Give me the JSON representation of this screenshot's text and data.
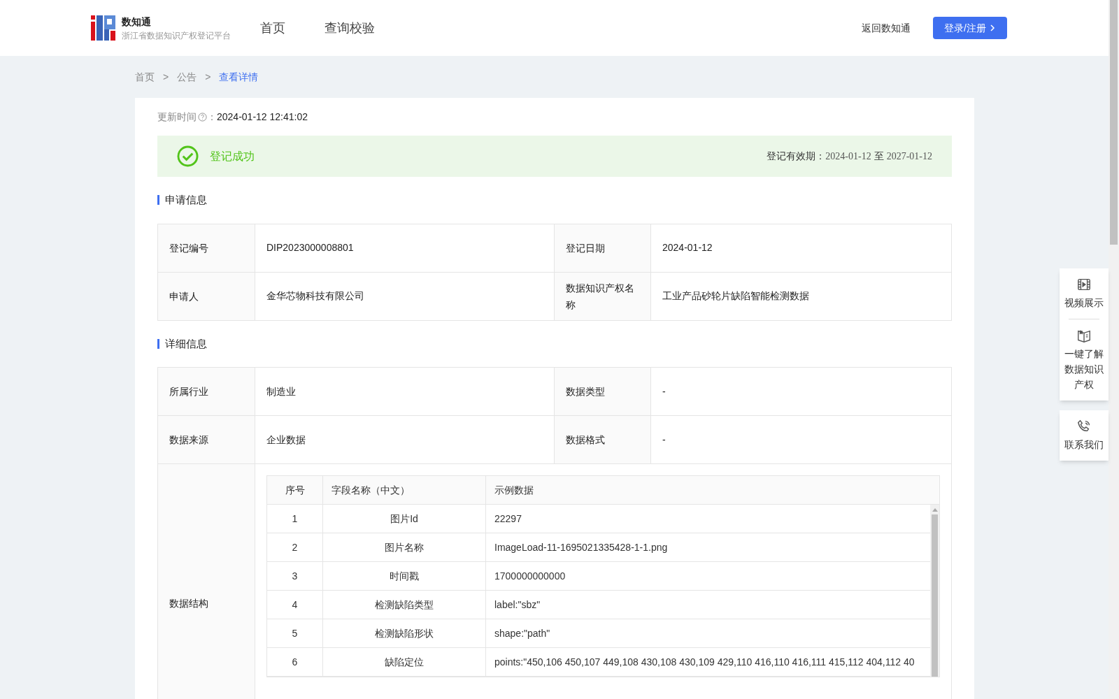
{
  "header": {
    "logo_title": "数知通",
    "logo_subtitle": "浙江省数据知识产权登记平台",
    "nav": [
      {
        "label": "首页",
        "selected": false
      },
      {
        "label": "查询校验",
        "selected": false
      }
    ],
    "back_link": "返回数知通",
    "login_button": "登录/注册"
  },
  "breadcrumb": [
    {
      "label": "首页",
      "selected": false
    },
    {
      "label": "公告",
      "selected": false
    },
    {
      "label": "查看详情",
      "selected": true
    }
  ],
  "separator": ">",
  "update": {
    "label": "更新时间",
    "colon": "：",
    "value": "2024-01-12 12:41:02"
  },
  "status": {
    "text": "登记成功",
    "validity_label": "登记有效期：",
    "validity_from": "2024-01-12",
    "validity_to_word": "至",
    "validity_to": "2027-01-12"
  },
  "application": {
    "title": "申请信息",
    "rows": [
      {
        "cells": [
          "登记编号",
          "DIP2023000008801",
          "登记日期",
          "2024-01-12"
        ]
      },
      {
        "cells": [
          "申请人",
          "金华芯物科技有限公司",
          "数据知识产权名称",
          "工业产品砂轮片缺陷智能检测数据"
        ]
      }
    ]
  },
  "details": {
    "title": "详细信息",
    "rows": [
      {
        "cells": [
          "所属行业",
          "制造业",
          "数据类型",
          "-"
        ]
      },
      {
        "cells": [
          "数据来源",
          "企业数据",
          "数据格式",
          "-"
        ]
      }
    ],
    "structure_label": "数据结构",
    "structure": {
      "columns": [
        "序号",
        "字段名称（中文）",
        "示例数据"
      ],
      "rows": [
        [
          "1",
          "图片Id",
          "22297"
        ],
        [
          "2",
          "图片名称",
          "ImageLoad-11-1695021335428-1-1.png"
        ],
        [
          "3",
          "时间戳",
          "1700000000000"
        ],
        [
          "4",
          "检测缺陷类型",
          "label:\"sbz\""
        ],
        [
          "5",
          "检测缺陷形状",
          "shape:\"path\""
        ],
        [
          "6",
          "缺陷定位",
          "points:\"450,106 450,107 449,108 430,108 430,109 429,110 416,110 416,111 415,112 404,112 40"
        ]
      ]
    }
  },
  "side_panel": [
    {
      "kind": "video",
      "label": "视频展示"
    },
    {
      "kind": "book",
      "label": "一键了解数据知识产权"
    },
    {
      "kind": "phone",
      "label": "联系我们"
    }
  ]
}
